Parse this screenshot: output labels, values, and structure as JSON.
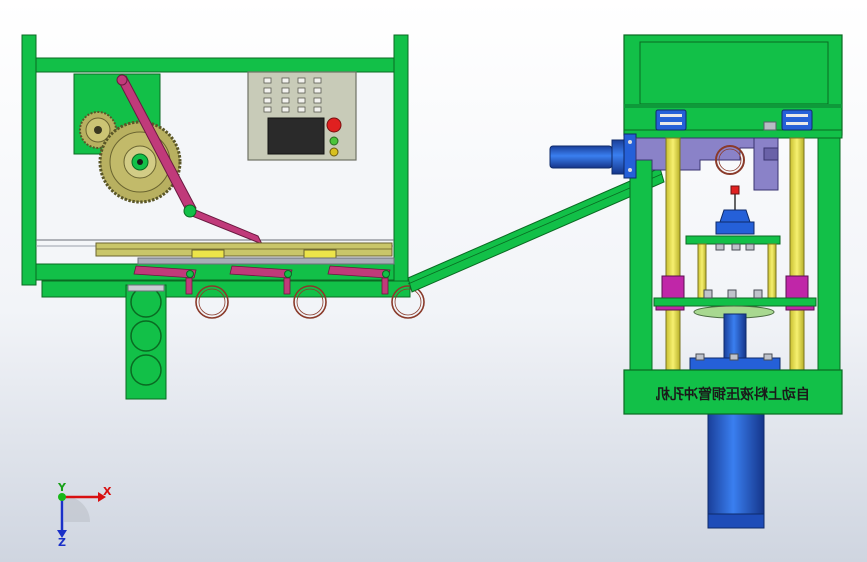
{
  "caption_plate": {
    "text": "自动上料液压铜管冲孔机",
    "mirrored": true
  },
  "triad": {
    "x_label": "X",
    "y_label": "Y",
    "z_label": "Z"
  },
  "colors": {
    "frame_green": "#12c048",
    "frame_edge": "#0a6a22",
    "gear_khaki": "#b8b060",
    "linkage_magenta": "#c03a7a",
    "panel_gray": "#c8cbb8",
    "screen_dark": "#2a2a2a",
    "cylinder_blue": "#2560d8",
    "column_yellow": "#ece44a",
    "slide_purple": "#8a82c8"
  }
}
